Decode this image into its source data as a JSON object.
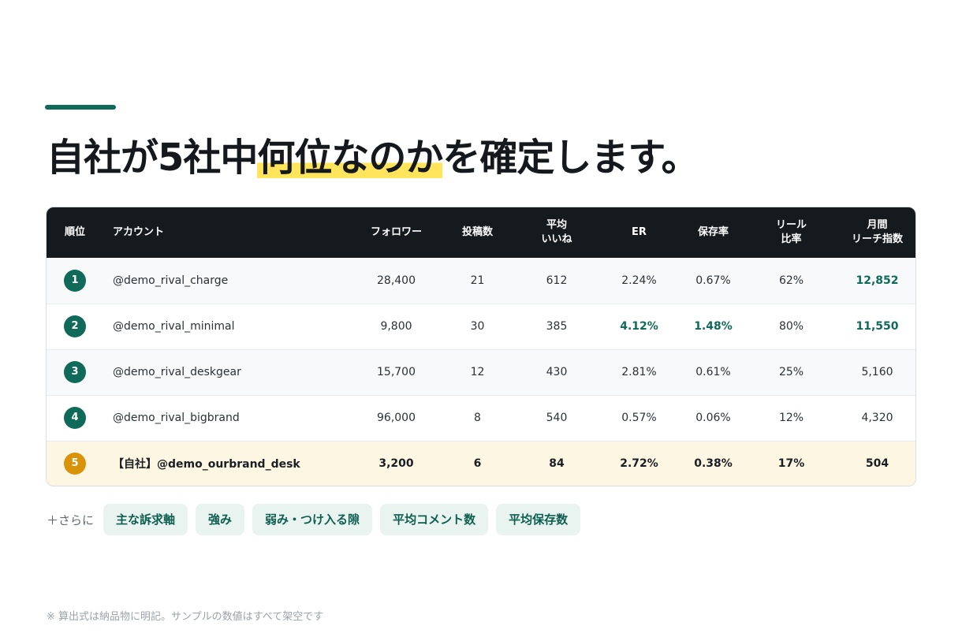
{
  "headline": {
    "prefix": "自社が5社中",
    "highlight": "何位なのか",
    "suffix": "を確定します。"
  },
  "table": {
    "headers": {
      "rank": "順位",
      "account": "アカウント",
      "followers": "フォロワー",
      "posts": "投稿数",
      "avg_likes_line1": "平均",
      "avg_likes_line2": "いいね",
      "er": "ER",
      "save_rate": "保存率",
      "reel_line1": "リール",
      "reel_line2": "比率",
      "reach_line1": "月間",
      "reach_line2": "リーチ指数"
    },
    "rows": [
      {
        "rank": "1",
        "account": "@demo_rival_charge",
        "followers": "28,400",
        "posts": "21",
        "avg_likes": "612",
        "er": "2.24%",
        "save_rate": "0.67%",
        "reel_ratio": "62%",
        "reach": "12,852"
      },
      {
        "rank": "2",
        "account": "@demo_rival_minimal",
        "followers": "9,800",
        "posts": "30",
        "avg_likes": "385",
        "er": "4.12%",
        "save_rate": "1.48%",
        "reel_ratio": "80%",
        "reach": "11,550"
      },
      {
        "rank": "3",
        "account": "@demo_rival_deskgear",
        "followers": "15,700",
        "posts": "12",
        "avg_likes": "430",
        "er": "2.81%",
        "save_rate": "0.61%",
        "reel_ratio": "25%",
        "reach": "5,160"
      },
      {
        "rank": "4",
        "account": "@demo_rival_bigbrand",
        "followers": "96,000",
        "posts": "8",
        "avg_likes": "540",
        "er": "0.57%",
        "save_rate": "0.06%",
        "reel_ratio": "12%",
        "reach": "4,320"
      },
      {
        "rank": "5",
        "account": "【自社】@demo_ourbrand_desk",
        "followers": "3,200",
        "posts": "6",
        "avg_likes": "84",
        "er": "2.72%",
        "save_rate": "0.38%",
        "reel_ratio": "17%",
        "reach": "504"
      }
    ]
  },
  "more": {
    "label": "＋さらに",
    "chips": [
      "主な訴求軸",
      "強み",
      "弱み・つけ入る隙",
      "平均コメント数",
      "平均保存数"
    ]
  },
  "footnote": "※ 算出式は納品物に明記。サンプルの数値はすべて架空です",
  "colors": {
    "accent": "#0f6a5a",
    "highlight": "#ffe45c",
    "header_bg": "#151a1f",
    "own_row_bg": "#fdf6e3",
    "own_rank_badge": "#d9930a"
  }
}
